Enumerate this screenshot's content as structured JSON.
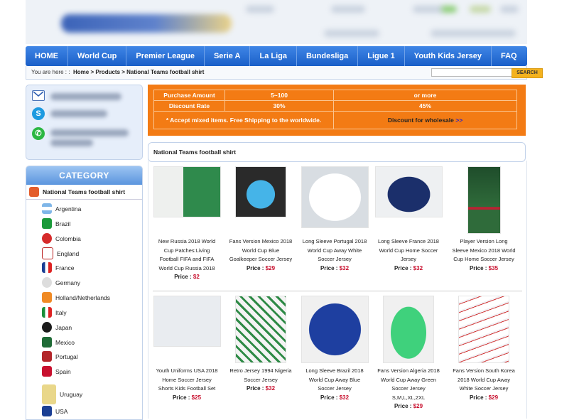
{
  "nav": [
    "HOME",
    "World Cup",
    "Premier League",
    "Serie A",
    "La Liga",
    "Bundesliga",
    "Ligue 1",
    "Youth Kids Jersey",
    "FAQ"
  ],
  "breadcrumb": {
    "prefix": "You are here : :",
    "home": "Home",
    "sep1": " > ",
    "products": "Products",
    "sep2": " > ",
    "current": "National Teams football shirt"
  },
  "search": {
    "button": "SEARCH",
    "placeholder": ""
  },
  "contact_icons": [
    "mail-icon",
    "skype-icon",
    "whatsapp-icon"
  ],
  "category": {
    "title": "CATEGORY",
    "section": "National Teams football shirt",
    "items": [
      "Argentina",
      "Brazil",
      "Colombia",
      "England",
      "France",
      "Germany",
      "Holland/Netherlands",
      "Italy",
      "Japan",
      "Mexico",
      "Portugal",
      "Spain",
      "Uruguay",
      "USA"
    ]
  },
  "promo": {
    "r1c1": "Purchase Amount",
    "r1c2": "5~100",
    "r1c3": "or more",
    "r2c1": "Discount Rate",
    "r2c2": "30%",
    "r2c3": "45%",
    "note": "* Accept mixed items. Free Shipping to the worldwide.",
    "wholesale": "Discount for wholesale",
    "wholesale_arrow": ">>"
  },
  "section_title": "National Teams football shirt",
  "products": [
    {
      "lines": [
        "New Russia 2018 World",
        "Cup Patches:Living",
        "Football FIFA and FIFA",
        "World Cup Russia 2018"
      ],
      "price_label": "Price :",
      "price": "$2"
    },
    {
      "lines": [
        "Fans Version Mexico 2018",
        "World Cup Blue",
        "Goalkeeper Soccer Jersey"
      ],
      "price_label": "Price :",
      "price": "$29"
    },
    {
      "lines": [
        "Long Sleeve Portugal 2018",
        "World Cup Away White",
        "Soccer Jersey"
      ],
      "price_label": "Price :",
      "price": "$32"
    },
    {
      "lines": [
        "Long Sleeve France 2018",
        "World Cup Home Soccer",
        "Jersey"
      ],
      "price_label": "Price :",
      "price": "$32"
    },
    {
      "lines": [
        "Player Version Long",
        "Sleeve Mexico 2018 World",
        "Cup Home Soccer Jersey"
      ],
      "price_label": "Price :",
      "price": "$35"
    },
    {
      "lines": [
        "Youth Uniforms USA 2018",
        "Home Soccer Jersey",
        "Shorts Kids Football Set"
      ],
      "price_label": "Price :",
      "price": "$25"
    },
    {
      "lines": [
        "Retro Jersey 1994 Nigeria",
        "Soccer Jersey"
      ],
      "price_label": "Price :",
      "price": "$32"
    },
    {
      "lines": [
        "Long Sleeve Brazil 2018",
        "World Cup Away Blue",
        "Soccer Jersey"
      ],
      "price_label": "Price :",
      "price": "$32"
    },
    {
      "lines": [
        "Fans Version Algeria 2018",
        "World Cup Away Green",
        "Soccer Jersey",
        "S,M,L,XL,2XL"
      ],
      "price_label": "Price :",
      "price": "$29"
    },
    {
      "lines": [
        "Fans Version South Korea",
        "2018 World Cup Away",
        "White Soccer Jersey"
      ],
      "price_label": "Price :",
      "price": "$29"
    }
  ],
  "colors": {
    "nav": "#1a5fc8",
    "promo": "#f37b14",
    "price": "#c8102e",
    "search_button": "#f4b21e"
  }
}
